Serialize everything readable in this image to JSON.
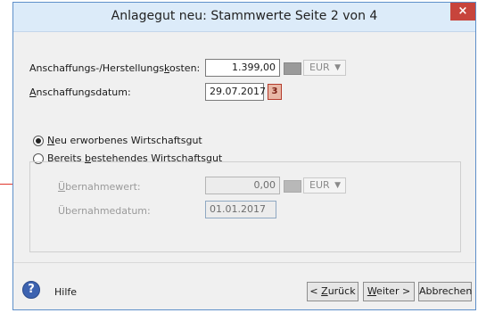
{
  "window": {
    "title": "Anlagegut neu: Stammwerte Seite 2 von 4",
    "close_glyph": "×"
  },
  "form": {
    "cost_label": {
      "before": "Anschaffungs-/Herstellungs",
      "underlined": "k",
      "after": "osten:"
    },
    "cost_value": "1.399,00",
    "cost_currency": "EUR",
    "date_label": {
      "underlined": "A",
      "after": "nschaffungsdatum:"
    },
    "date_value": "29.07.2017",
    "calendar_icon": "calendar-icon"
  },
  "options": {
    "new_asset": {
      "underlined": "N",
      "after": "eu erworbenes Wirtschaftsgut",
      "checked": true
    },
    "existing_asset": {
      "before": "Bereits ",
      "underlined": "b",
      "after": "estehendes Wirtschaftsgut",
      "checked": false
    }
  },
  "takeover": {
    "value_label": {
      "underlined": "Ü",
      "after": "bernahmewert:"
    },
    "value": "0,00",
    "currency": "EUR",
    "date_label": "Übernahmedatum:",
    "date_value": "01.01.2017"
  },
  "footer": {
    "help_glyph": "?",
    "help_label": "Hilfe",
    "back": {
      "before": "< ",
      "underlined": "Z",
      "after": "urück"
    },
    "next": {
      "underlined": "W",
      "after": "eiter >"
    },
    "cancel": "Abbrechen"
  },
  "colors": {
    "title_bar": "#dcebf9",
    "close_button": "#c7443c",
    "annotation_pointer": "#e0372c"
  }
}
